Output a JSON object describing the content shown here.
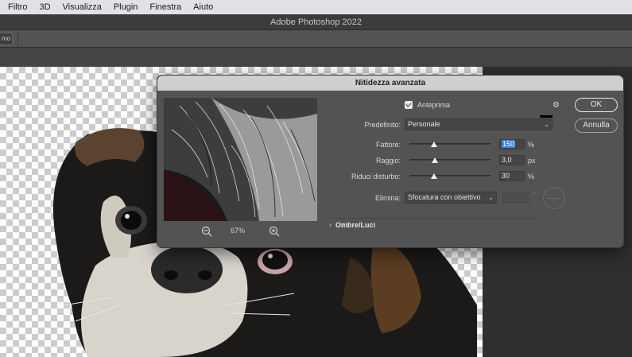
{
  "menubar": {
    "items": [
      "Filtro",
      "3D",
      "Visualizza",
      "Plugin",
      "Finestra",
      "Aiuto"
    ]
  },
  "app": {
    "title": "Adobe Photoshop 2022"
  },
  "optbar": {
    "mini_label": "mo"
  },
  "dialog": {
    "title": "Nitidezza avanzata",
    "preview_checkbox_label": "Anteprima",
    "preview_checked": true,
    "preset_label": "Predefinito:",
    "preset_value": "Personale",
    "amount_label": "Fattore:",
    "amount_value": "150",
    "amount_unit": "%",
    "amount_slider_fraction": 0.3,
    "radius_label": "Raggio:",
    "radius_value": "3,0",
    "radius_unit": "px",
    "radius_slider_fraction": 0.31,
    "noise_label": "Riduci disturbo:",
    "noise_value": "30",
    "noise_unit": "%",
    "noise_slider_fraction": 0.3,
    "remove_label": "Elimina:",
    "remove_value": "Sfocatura con obiettivo",
    "angle_unit": "°",
    "zoom_value": "67%",
    "ok_label": "OK",
    "cancel_label": "Annulla",
    "shadows_label": "Ombre/Luci"
  },
  "colors": {
    "dialog_bg": "#535353",
    "accent": "#3d82d6",
    "canvas_dark": "#2f2f2f"
  }
}
